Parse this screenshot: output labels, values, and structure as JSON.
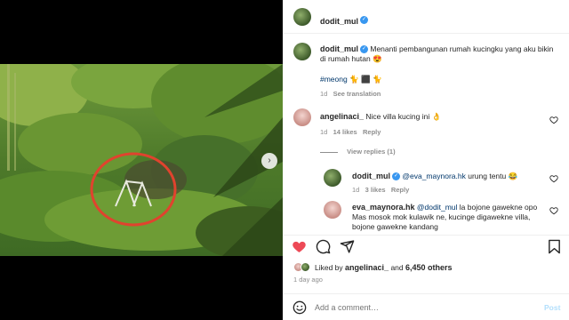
{
  "post": {
    "username": "dodit_mul",
    "caption": "Menanti pembangunan rumah kucingku yang aku bikin di rumah hutan",
    "caption_emoji": "😍",
    "hashtag": "#meong",
    "hashtag_emojis": "🐈 ⬛ 🐈",
    "caption_age": "1d",
    "see_translation": "See translation"
  },
  "comments": [
    {
      "username": "angelinaci_",
      "text": "Nice villa kucing ini",
      "emoji": "👌",
      "age": "1d",
      "likes": "14 likes",
      "reply": "Reply",
      "view_replies": "View replies (1)"
    },
    {
      "username": "dodit_mul",
      "mention": "@eva_maynora.hk",
      "text": "urung tentu",
      "emoji": "😂",
      "age": "1d",
      "likes": "3 likes",
      "reply": "Reply"
    },
    {
      "username": "eva_maynora.hk",
      "mention": "@dodit_mul",
      "text_line1": "la bojone gawekne opo",
      "text_line2": "Mas mosok mok kulawik ne, kucinge digawekne villa,",
      "text_line3": "bojone gawekne kandang"
    }
  ],
  "likes": {
    "prefix": "Liked by",
    "first_user": "angelinaci_",
    "and": "and",
    "others": "6,450 others"
  },
  "post_age": "1 day ago",
  "composer": {
    "placeholder": "Add a comment…",
    "post_label": "Post"
  },
  "colors": {
    "like_red": "#ed4956",
    "link_blue": "#00376b",
    "verified_blue": "#3897f0",
    "post_disabled": "#b2dffc"
  },
  "carousel": {
    "dot_count": 5,
    "active_dot": 1
  }
}
